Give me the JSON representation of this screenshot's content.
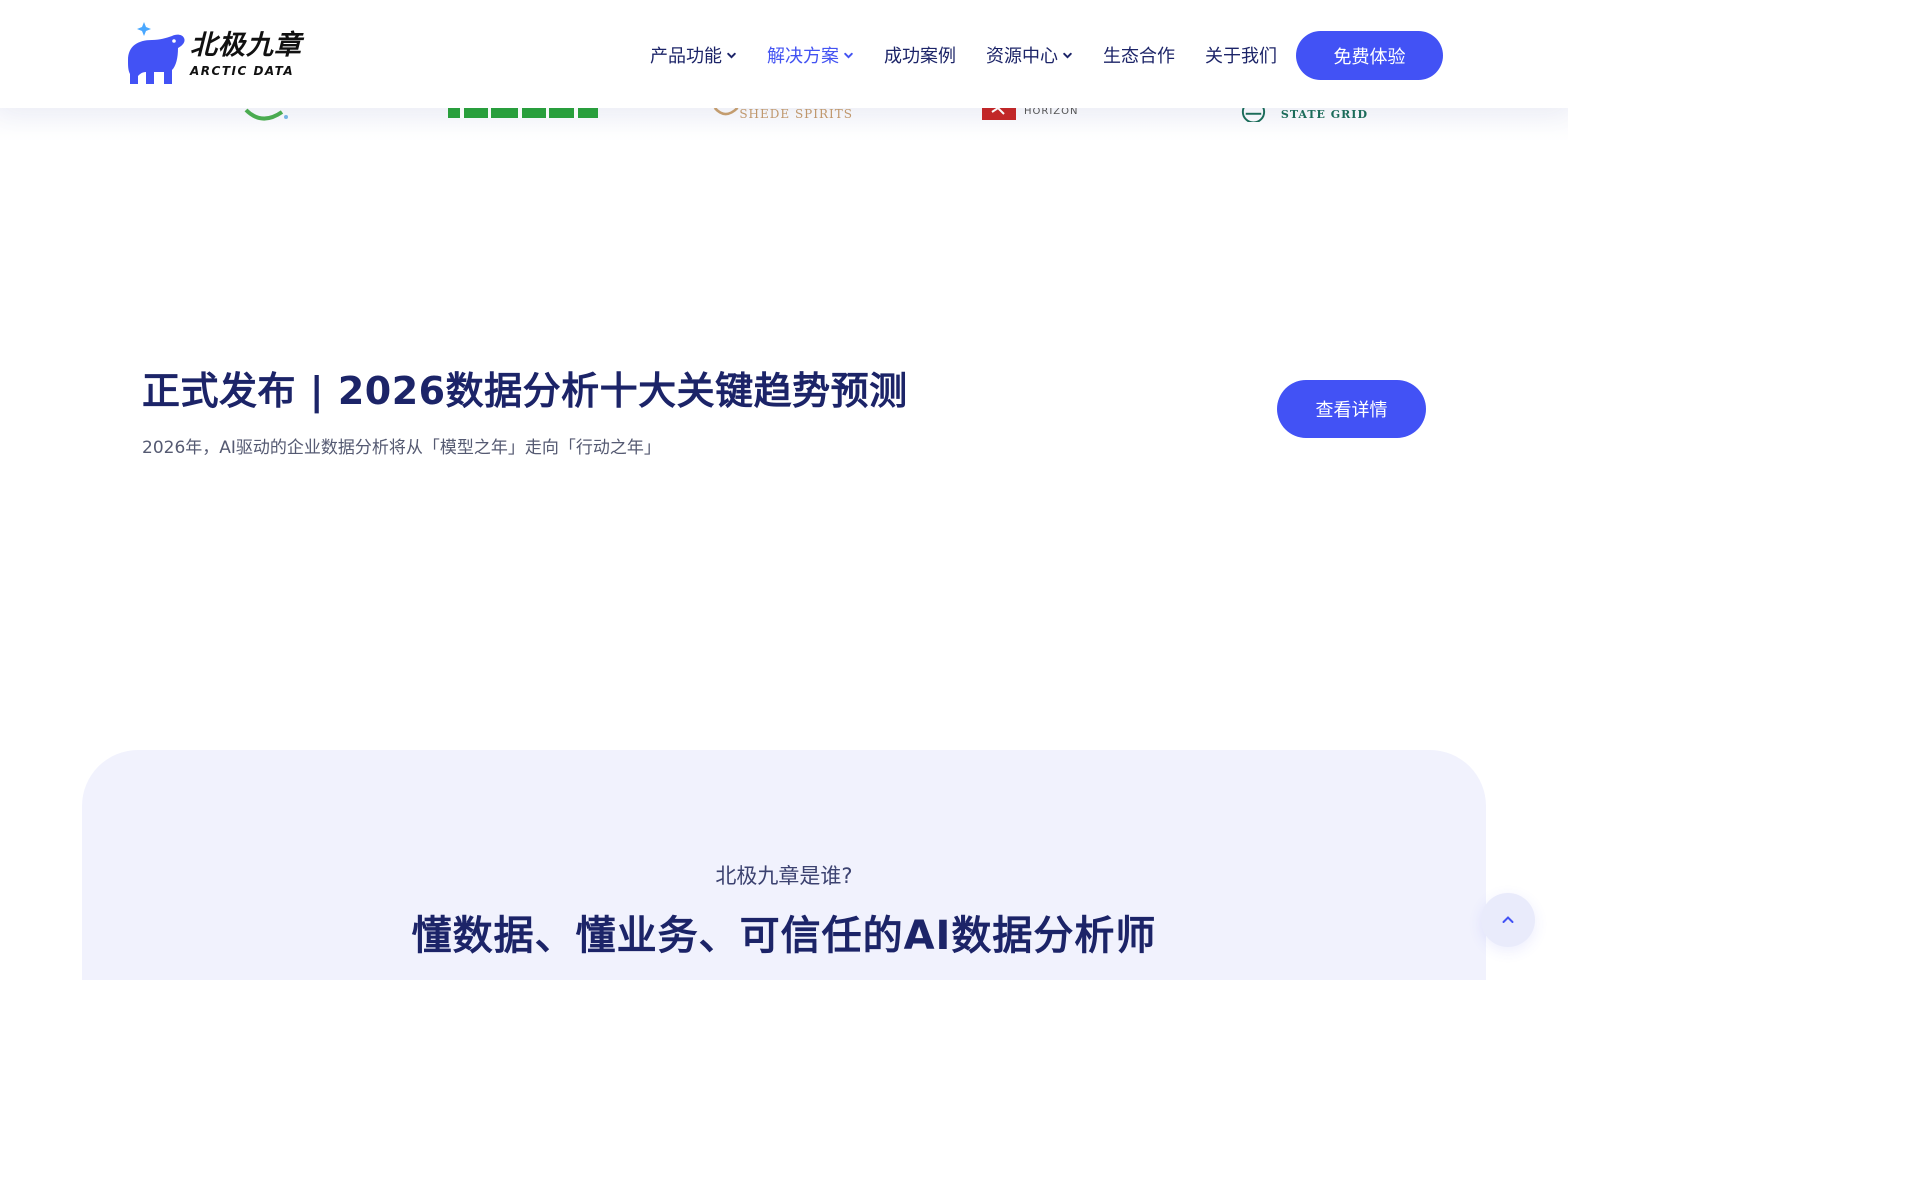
{
  "brand": {
    "name_cn": "北极九章",
    "name_en": "ARCTIC DATA",
    "primary_color": "#4252f5",
    "navy_color": "#1c2468",
    "logo_icon": "polar-bear-icon"
  },
  "nav": {
    "items": [
      {
        "label": "产品功能",
        "has_dropdown": true,
        "active": false
      },
      {
        "label": "解决方案",
        "has_dropdown": true,
        "active": true
      },
      {
        "label": "成功案例",
        "has_dropdown": false,
        "active": false
      },
      {
        "label": "资源中心",
        "has_dropdown": true,
        "active": false
      },
      {
        "label": "生态合作",
        "has_dropdown": false,
        "active": false
      },
      {
        "label": "关于我们",
        "has_dropdown": false,
        "active": false
      }
    ],
    "cta_label": "免费体验"
  },
  "clients": {
    "shede": "SHEDE SPIRITS",
    "horizon": "HORIZON",
    "state_grid": "STATE GRID"
  },
  "banner": {
    "title": "正式发布 | 2026数据分析十大关键趋势预测",
    "subtitle": "2026年，AI驱动的企业数据分析将从「模型之年」走向「行动之年」",
    "button_label": "查看详情"
  },
  "about": {
    "eyebrow": "北极九章是谁?",
    "heading": "懂数据、懂业务、可信任的AI数据分析师"
  },
  "widgets": {
    "back_to_top_icon": "chevron-up-icon"
  }
}
